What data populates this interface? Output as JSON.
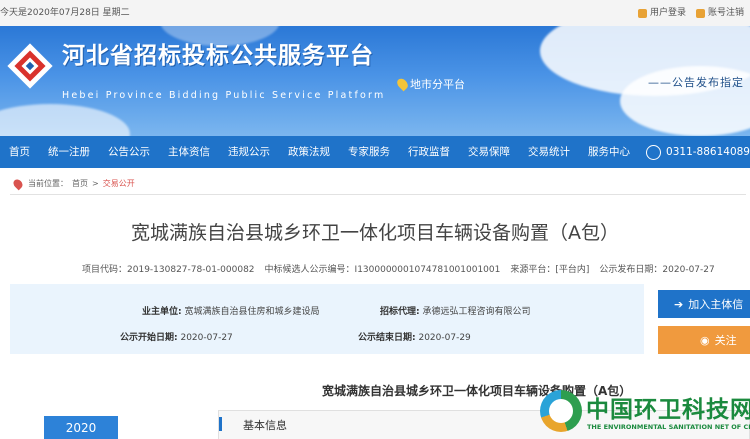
{
  "topbar": {
    "date_text": "今天是2020年07月28日 星期二",
    "user_login": "用户登录",
    "account_logout": "账号注销"
  },
  "banner": {
    "title_cn": "河北省招标投标公共服务平台",
    "title_en": "Hebei Province Bidding Public Service Platform",
    "city_label": "地市分平台",
    "slogan": "——公告发布指定"
  },
  "nav": {
    "items": [
      "首页",
      "统一注册",
      "公告公示",
      "主体资信",
      "违规公示",
      "政策法规",
      "专家服务",
      "行政监督",
      "交易保障",
      "交易统计",
      "服务中心"
    ],
    "phone": "0311-88614089"
  },
  "breadcrumb": {
    "label": "当前位置：",
    "home": "首页",
    "sep": ">",
    "current": "交易公开"
  },
  "project": {
    "title": "宽城满族自治县城乡环卫一体化项目车辆设备购置（A包）",
    "code_label": "项目代码：",
    "code": "2019-130827-78-01-000082",
    "notice_no_label": "中标候选人公示编号：",
    "notice_no": "I13000000010747810010010​01",
    "source_label": "来源平台：",
    "source": "[平台内]",
    "publish_label": "公示发布日期：",
    "publish_date": "2020-07-27"
  },
  "info": {
    "owner_label": "业主单位:",
    "owner": "宽城满族自治县住房和城乡建设局",
    "agent_label": "招标代理:",
    "agent": "承德远弘工程咨询有限公司",
    "start_label": "公示开始日期:",
    "start_date": "2020-07-27",
    "end_label": "公示结束日期:",
    "end_date": "2020-07-29"
  },
  "actions": {
    "join": "加入主体信",
    "follow": "关注"
  },
  "content": {
    "subtitle": "宽城满族自治县城乡环卫一体化项目车辆设备购置（A包）",
    "year": "2020",
    "section": "基本信息"
  },
  "watermark": {
    "cn": "中国环卫科技网",
    "en": "THE ENVIRONMENTAL SANITATION NET OF CHINA"
  },
  "colors": {
    "nav_blue": "#1f73c9",
    "follow_orange": "#f09a3e",
    "info_bg": "#eaf4fd"
  }
}
